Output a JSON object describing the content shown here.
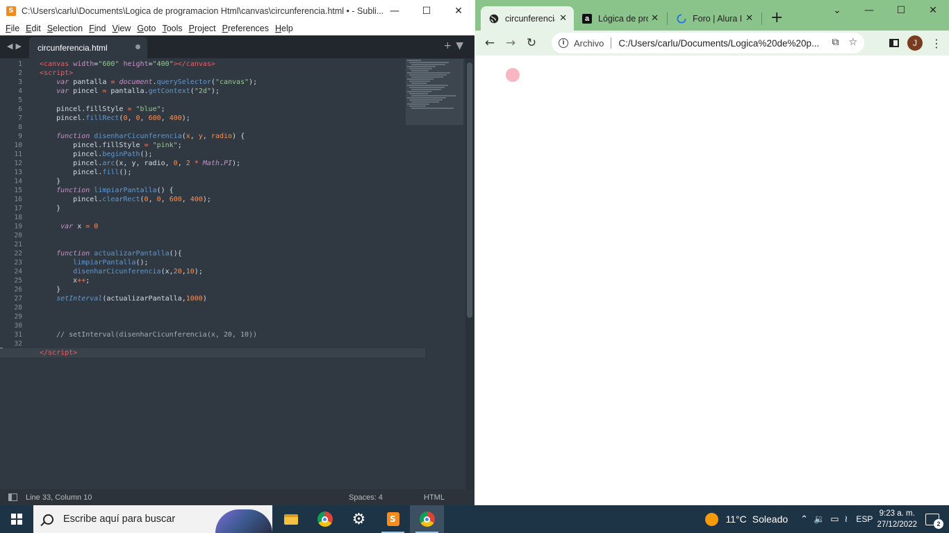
{
  "sublime": {
    "title": "C:\\Users\\carlu\\Documents\\Logica de programacion Html\\canvas\\circunferencia.html • - Subli...",
    "menu": [
      "File",
      "Edit",
      "Selection",
      "Find",
      "View",
      "Goto",
      "Tools",
      "Project",
      "Preferences",
      "Help"
    ],
    "tab_label": "circunferencia.html",
    "line_numbers": [
      "1",
      "2",
      "3",
      "4",
      "5",
      "6",
      "7",
      "8",
      "9",
      "10",
      "11",
      "12",
      "13",
      "14",
      "15",
      "16",
      "17",
      "18",
      "19",
      "20",
      "21",
      "22",
      "23",
      "24",
      "25",
      "26",
      "27",
      "28",
      "29",
      "30",
      "31",
      "32",
      "33"
    ],
    "status": {
      "position": "Line 33, Column 10",
      "spaces": "Spaces: 4",
      "syntax": "HTML"
    }
  },
  "chrome": {
    "tabs": [
      {
        "title": "circunferencia.ht",
        "icon": "globe-icon"
      },
      {
        "title": "Lógica de progr",
        "icon": "alura-icon"
      },
      {
        "title": "Foro | Alura Lat",
        "icon": "loading-icon"
      }
    ],
    "omnibox": {
      "security_label": "Archivo",
      "url": "C:/Users/carlu/Documents/Logica%20de%20p..."
    },
    "profile_initial": "J",
    "canvas_circle_color": "#f7b6c2"
  },
  "taskbar": {
    "search_placeholder": "Escribe aquí para buscar",
    "weather_temp": "11°C",
    "weather_text": "Soleado",
    "language": "ESP",
    "time": "9:23 a. m.",
    "date": "27/12/2022",
    "notifications": "2"
  }
}
